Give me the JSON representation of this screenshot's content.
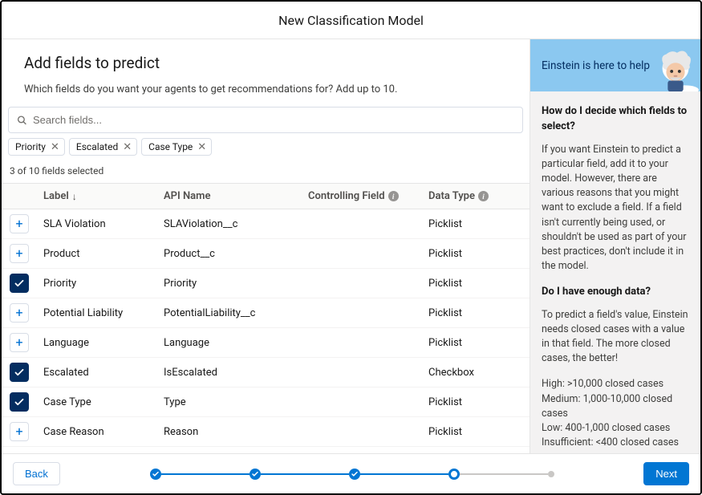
{
  "title": "New Classification Model",
  "intro": {
    "heading": "Add fields to predict",
    "sub": "Which fields do you want your agents to get recommendations for? Add up to 10."
  },
  "search": {
    "placeholder": "Search fields..."
  },
  "chips": [
    {
      "label": "Priority"
    },
    {
      "label": "Escalated"
    },
    {
      "label": "Case Type"
    }
  ],
  "count_text": "3 of 10 fields selected",
  "columns": {
    "label": "Label",
    "api": "API Name",
    "controlling": "Controlling Field",
    "datatype": "Data Type"
  },
  "rows": [
    {
      "selected": false,
      "label": "SLA Violation",
      "api": "SLAViolation__c",
      "controlling": "",
      "datatype": "Picklist"
    },
    {
      "selected": false,
      "label": "Product",
      "api": "Product__c",
      "controlling": "",
      "datatype": "Picklist"
    },
    {
      "selected": true,
      "label": "Priority",
      "api": "Priority",
      "controlling": "",
      "datatype": "Picklist"
    },
    {
      "selected": false,
      "label": "Potential Liability",
      "api": "PotentialLiability__c",
      "controlling": "",
      "datatype": "Picklist"
    },
    {
      "selected": false,
      "label": "Language",
      "api": "Language",
      "controlling": "",
      "datatype": "Picklist"
    },
    {
      "selected": true,
      "label": "Escalated",
      "api": "IsEscalated",
      "controlling": "",
      "datatype": "Checkbox"
    },
    {
      "selected": true,
      "label": "Case Type",
      "api": "Type",
      "controlling": "",
      "datatype": "Picklist"
    },
    {
      "selected": false,
      "label": "Case Reason",
      "api": "Reason",
      "controlling": "",
      "datatype": "Picklist"
    }
  ],
  "side": {
    "hero": "Einstein is here to help",
    "q1": "How do I decide which fields to select?",
    "a1": "If you want Einstein to predict a particular field, add it to your model. However, there are various reasons that you might want to exclude a field. If a field isn't currently being used, or shouldn't be used as part of your best practices, don't include it in the model.",
    "q2": "Do I have enough data?",
    "a2": "To predict a field's value, Einstein needs closed cases with a value in that field. The more closed cases, the better!",
    "tiers": "High: >10,000 closed cases\nMedium: 1,000-10,000 closed cases\nLow: 400-1,000 closed cases\nInsufficient: <400 closed cases"
  },
  "footer": {
    "back": "Back",
    "next": "Next"
  },
  "stepper": {
    "completed": 3,
    "current_index": 3,
    "total": 5
  }
}
